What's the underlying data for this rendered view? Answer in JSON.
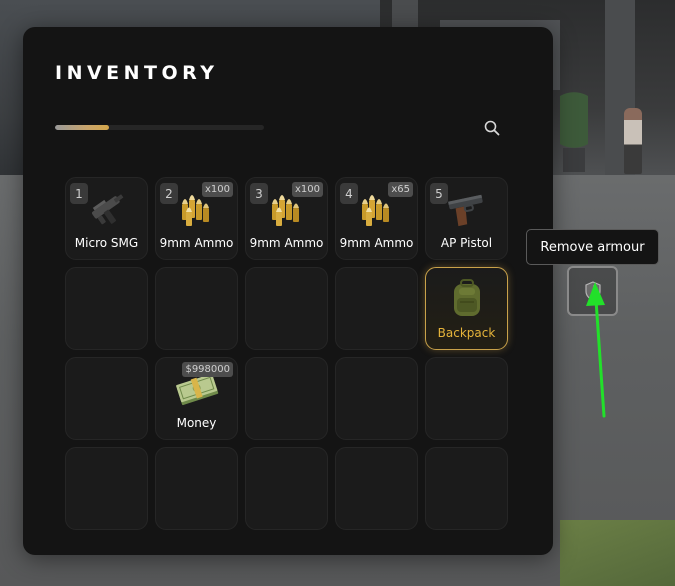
{
  "inventory": {
    "title": "INVENTORY",
    "weight_fraction": 0.26,
    "search_icon": "search-icon",
    "slots": [
      {
        "slot": "1",
        "label": "Micro SMG",
        "badge": "",
        "icon": "micro-smg-icon"
      },
      {
        "slot": "2",
        "label": "9mm Ammo",
        "badge": "x100",
        "icon": "ammo-icon"
      },
      {
        "slot": "3",
        "label": "9mm Ammo",
        "badge": "x100",
        "icon": "ammo-icon"
      },
      {
        "slot": "4",
        "label": "9mm Ammo",
        "badge": "x65",
        "icon": "ammo-icon"
      },
      {
        "slot": "5",
        "label": "AP Pistol",
        "badge": "",
        "icon": "pistol-icon"
      },
      {
        "slot": "",
        "label": "",
        "badge": "",
        "icon": ""
      },
      {
        "slot": "",
        "label": "",
        "badge": "",
        "icon": ""
      },
      {
        "slot": "",
        "label": "",
        "badge": "",
        "icon": ""
      },
      {
        "slot": "",
        "label": "",
        "badge": "",
        "icon": ""
      },
      {
        "slot": "",
        "label": "Backpack",
        "badge": "",
        "icon": "backpack-icon",
        "selected": true
      },
      {
        "slot": "",
        "label": "",
        "badge": "",
        "icon": ""
      },
      {
        "slot": "",
        "label": "Money",
        "badge": "$998000",
        "icon": "money-icon"
      },
      {
        "slot": "",
        "label": "",
        "badge": "",
        "icon": ""
      },
      {
        "slot": "",
        "label": "",
        "badge": "",
        "icon": ""
      },
      {
        "slot": "",
        "label": "",
        "badge": "",
        "icon": ""
      },
      {
        "slot": "",
        "label": "",
        "badge": "",
        "icon": ""
      },
      {
        "slot": "",
        "label": "",
        "badge": "",
        "icon": ""
      },
      {
        "slot": "",
        "label": "",
        "badge": "",
        "icon": ""
      },
      {
        "slot": "",
        "label": "",
        "badge": "",
        "icon": ""
      },
      {
        "slot": "",
        "label": "",
        "badge": "",
        "icon": ""
      }
    ]
  },
  "armour": {
    "tooltip": "Remove armour",
    "icon": "shield-icon"
  },
  "annotation": {
    "icon": "green-arrow-icon",
    "color": "#22e02a"
  },
  "colors": {
    "panel_bg": "#141414",
    "selected_accent": "#e5b33a"
  }
}
